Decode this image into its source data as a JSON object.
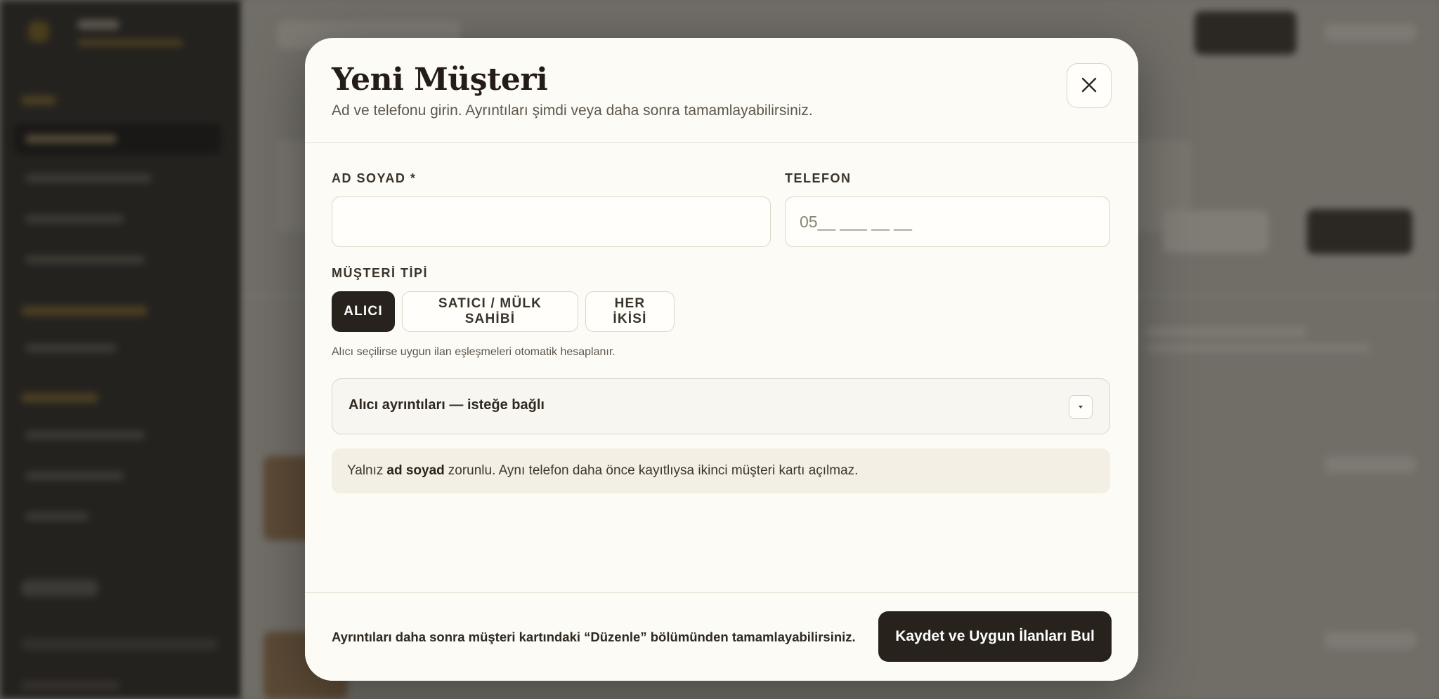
{
  "modal": {
    "title": "Yeni Müşteri",
    "subtitle": "Ad ve telefonu girin. Ayrıntıları şimdi veya daha sonra tamamlayabilirsiniz.",
    "close_icon": "close-icon",
    "fields": {
      "name_label": "AD SOYAD *",
      "name_value": "",
      "phone_label": "TELEFON",
      "phone_placeholder": "05__ ___ __ __"
    },
    "customer_type": {
      "label": "MÜŞTERİ TİPİ",
      "options": [
        "ALICI",
        "SATICI / MÜLK SAHİBİ",
        "HER İKİSİ"
      ],
      "selected": "ALICI",
      "hint": "Alıcı seçilirse uygun ilan eşleşmeleri otomatik hesaplanır."
    },
    "accordion": {
      "label": "Alıcı ayrıntıları — isteğe bağlı",
      "icon": "chevron-down-icon"
    },
    "note": {
      "prefix": "Yalnız",
      "bold": "ad soyad",
      "suffix": "zorunlu. Aynı telefon daha önce kayıtlıysa ikinci müşteri kartı açılmaz."
    },
    "footer": {
      "text": "Ayrıntıları daha sonra müşteri kartındaki “Düzenle” bölümünden tamamlayabilirsiniz.",
      "primary_button": "Kaydet ve Uygun İlanları Bul"
    }
  },
  "colors": {
    "overlay": "#6b6862",
    "sidebar": "#24221f",
    "modal_bg": "#fcfbf6",
    "primary": "#27221c",
    "note_bg": "#f4efe5"
  }
}
